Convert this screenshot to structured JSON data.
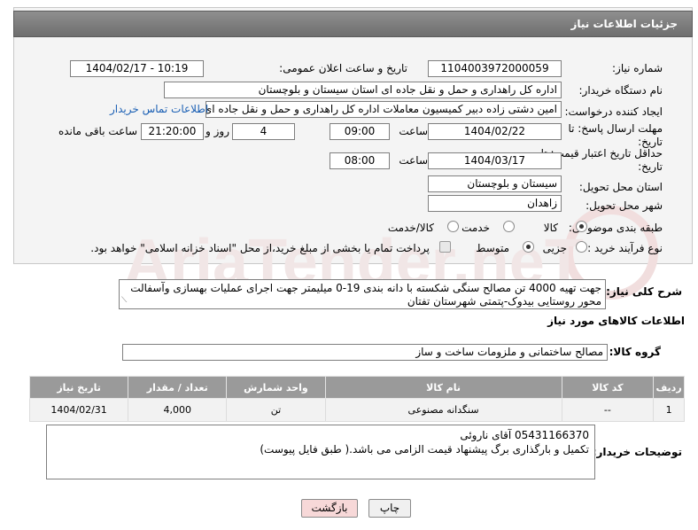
{
  "header": {
    "title": "جزئیات اطلاعات نیاز"
  },
  "form": {
    "need_number_label": "شماره نیاز:",
    "need_number": "1104003972000059",
    "announce_label": "تاریخ و ساعت اعلان عمومی:",
    "announce_value": "1404/02/17 - 10:19",
    "buyer_org_label": "نام دستگاه خریدار:",
    "buyer_org": "اداره کل راهداری و حمل و نقل جاده ای استان سیستان و بلوچستان",
    "creator_label": "ایجاد کننده درخواست:",
    "creator": "امین دشتی زاده دبیر کمیسیون معاملات اداره کل راهداری و حمل و نقل جاده ای",
    "contact_link": "اطلاعات تماس خریدار",
    "deadline_label": "مهلت ارسال پاسخ: تا تاریخ:",
    "deadline_date": "1404/02/22",
    "time_label": "ساعت",
    "deadline_time": "09:00",
    "days_value": "4",
    "days_label": "روز و",
    "remaining_time": "21:20:00",
    "remaining_label": "ساعت باقی مانده",
    "min_validity_label": "حداقل تاریخ اعتبار قیمت: تا تاریخ:",
    "validity_date": "1404/03/17",
    "validity_time": "08:00",
    "province_label": "استان محل تحویل:",
    "province": "سیستان و بلوچستان",
    "city_label": "شهر محل تحویل:",
    "city": "زاهدان",
    "category_label": "طبقه بندی موضوعی:",
    "category_options": [
      "کالا",
      "خدمت",
      "کالا/خدمت"
    ],
    "category_selected": "کالا",
    "process_label": "نوع فرآیند خرید :",
    "process_options": [
      "جزیی",
      "متوسط"
    ],
    "process_selected": "متوسط",
    "payment_note": "پرداخت تمام یا بخشی از مبلغ خرید،از محل \"اسناد خزانه اسلامی\" خواهد بود."
  },
  "description": {
    "label": "شرح کلی نیاز:",
    "text": "جهت تهیه 4000 تن مصالح سنگی شکسته با دانه بندی 19-0 میلیمتر جهت  اجرای عملیات بهسازی وآسفالت محور روستایی بیدوک-پتمتی شهرستان تفتان"
  },
  "goods": {
    "section_title": "اطلاعات کالاهای مورد نیاز",
    "group_label": "گروه کالا:",
    "group_value": "مصالح ساختمانی و ملزومات ساخت و ساز",
    "columns": [
      "ردیف",
      "کد کالا",
      "نام کالا",
      "واحد شمارش",
      "تعداد / مقدار",
      "تاریخ نیاز"
    ],
    "rows": [
      {
        "row": "1",
        "code": "--",
        "name": "سنگدانه مصنوعی",
        "unit": "تن",
        "qty": "4,000",
        "date": "1404/02/31"
      }
    ]
  },
  "buyer_notes": {
    "label": "توضیحات خریدار:",
    "line1": "05431166370 آقای ناروئی",
    "line2": "تکمیل و بارگذاری برگ پیشنهاد قیمت الزامی می باشد.( طبق فایل پیوست)"
  },
  "buttons": {
    "print": "چاپ",
    "back": "بازگشت"
  },
  "watermark": {
    "text": "AriaTender.neT"
  },
  "colors": {
    "header": "#7a7a7a",
    "link": "#1a5fb4",
    "back_button": "#f7d8d8"
  }
}
